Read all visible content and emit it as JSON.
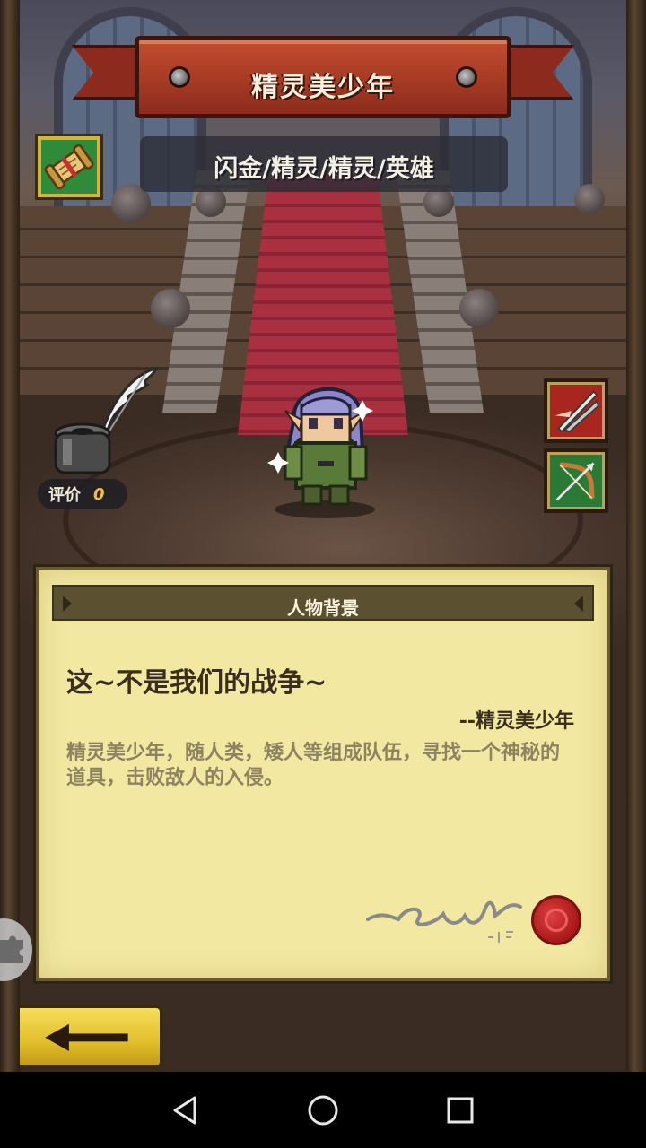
{
  "hero": {
    "name": "精灵美少年",
    "types": "闪金/精灵/精灵/英雄"
  },
  "rating": {
    "label": "评价",
    "value": "0"
  },
  "background_panel": {
    "title": "人物背景",
    "quote": "这~不是我们的战争~",
    "quote_author": "--精灵美少年",
    "description": "精灵美少年，随人类，矮人等组成队伍，寻找一个神秘的道具，击败敌人的入侵。"
  },
  "icons": {
    "scroll": "scroll-icon",
    "skill_1": "crossed-blades-icon",
    "skill_2": "bow-icon",
    "back": "arrow-left-icon",
    "nav_back": "triangle-back-icon",
    "nav_home": "circle-home-icon",
    "nav_recent": "square-recent-icon",
    "float": "puzzle-icon"
  },
  "colors": {
    "banner": "#a63a24",
    "parchment": "#f2e8a2",
    "skill_red": "#a8261e",
    "skill_green": "#2a7a36",
    "back_button": "#e2be2a",
    "rating_value": "#f0c030"
  }
}
